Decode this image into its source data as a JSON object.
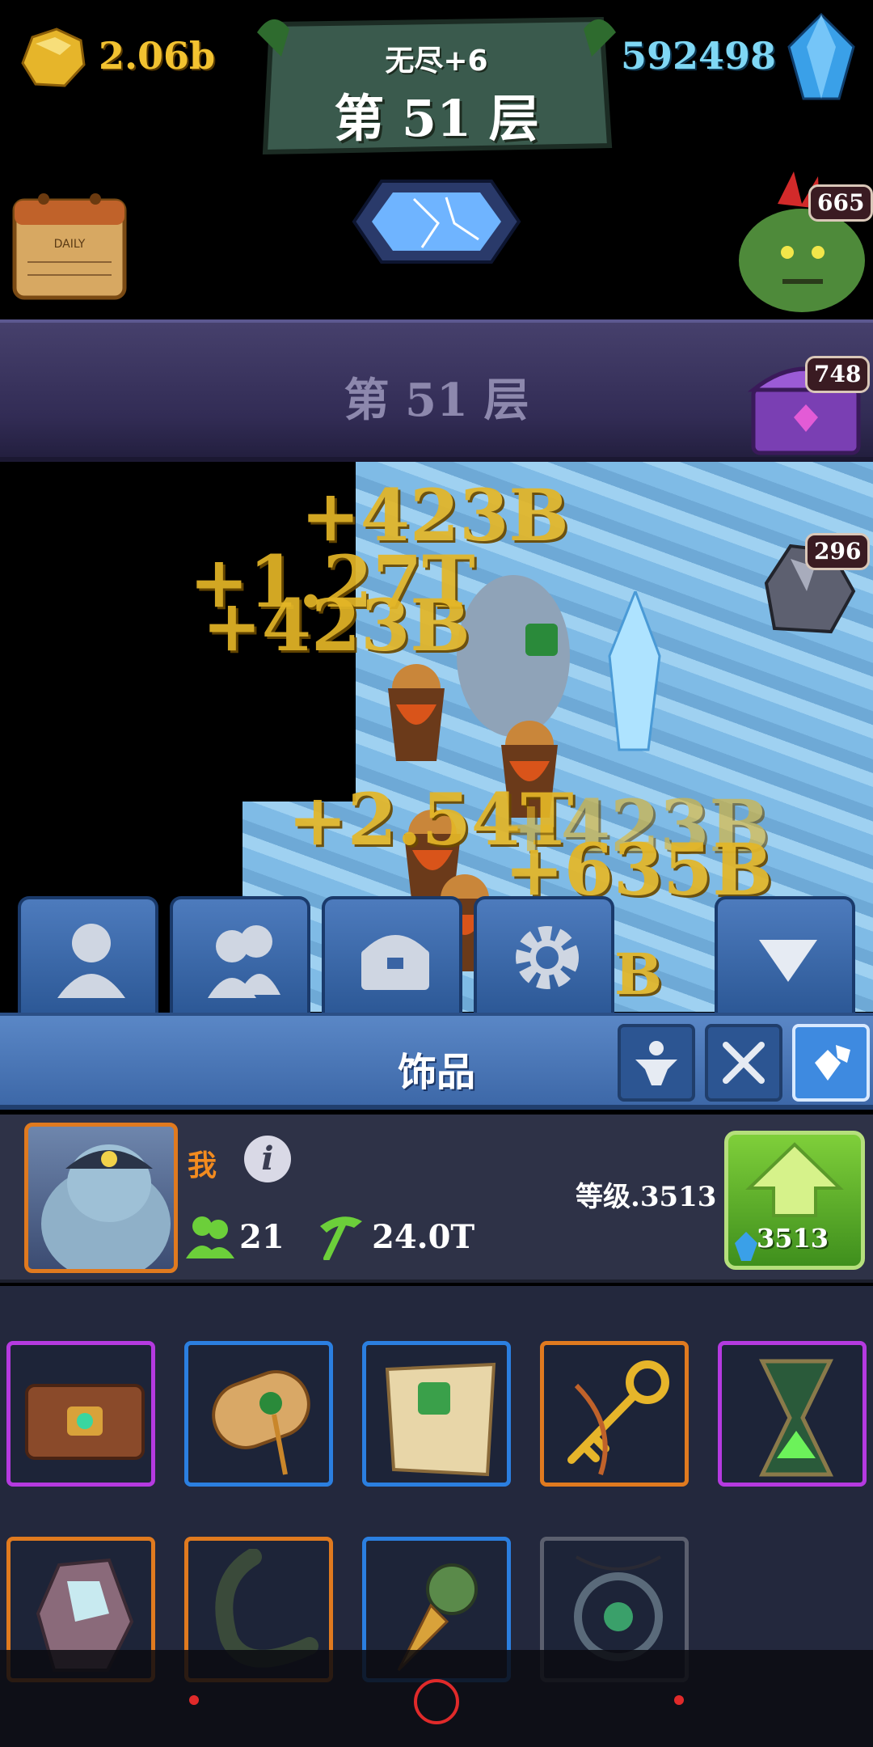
{
  "hud": {
    "gold": "2.06b",
    "gems": "592498",
    "floor_subtitle": "无尽+6",
    "floor_title": "第 51 层",
    "boss_badge": "665"
  },
  "mine": {
    "banner_label": "第 51 层",
    "chest_badge": "748",
    "ore_badge": "296",
    "floating_numbers": [
      "+423B",
      "+1.27T",
      "+423B",
      "+2.54T",
      "+423B",
      "+635B",
      "B"
    ]
  },
  "tabs": [
    {
      "icon": "miner-profile-icon"
    },
    {
      "icon": "miner-group-icon"
    },
    {
      "icon": "chest-icon"
    },
    {
      "icon": "settings-gear-icon"
    },
    {
      "icon": "collapse-arrow-icon"
    }
  ],
  "section": {
    "title": "饰品",
    "filters": [
      "strength-icon",
      "crossed-tools-icon",
      "gems-icon"
    ]
  },
  "player": {
    "name": "我",
    "workers": "21",
    "power": "24.0T",
    "level": "等级.3513",
    "upgrade_cost": "3513"
  },
  "inventory": [
    {
      "item": "spellbook-icon",
      "rarity": "purple"
    },
    {
      "item": "scroll-icon",
      "rarity": "blue"
    },
    {
      "item": "map-icon",
      "rarity": "blue"
    },
    {
      "item": "golden-key-icon",
      "rarity": "orange"
    },
    {
      "item": "hourglass-icon",
      "rarity": "purple"
    },
    {
      "item": "rune-crystal-icon",
      "rarity": "orange"
    },
    {
      "item": "horn-icon",
      "rarity": "orange"
    },
    {
      "item": "drill-icon",
      "rarity": "blue"
    },
    {
      "item": "amulet-icon",
      "rarity": "gray"
    }
  ],
  "colors": {
    "gold_text": "#f2c230",
    "gem_text": "#7fd7f4",
    "rarity_purple": "#b53ae0",
    "rarity_blue": "#2b7fe0",
    "rarity_orange": "#e07a1f",
    "rarity_gray": "#5b5f6e"
  }
}
